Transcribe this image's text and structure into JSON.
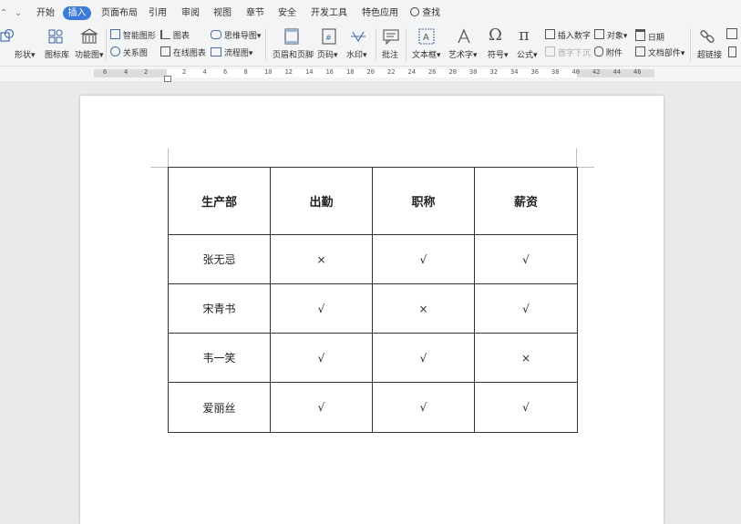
{
  "menubar": {
    "items": [
      "开始",
      "插入",
      "页面布局",
      "引用",
      "审阅",
      "视图",
      "章节",
      "安全",
      "开发工具",
      "特色应用"
    ],
    "active": "插入",
    "search": "查找"
  },
  "ribbon": {
    "shape": "形状",
    "icon_lib": "图标库",
    "function_chart": "功能图",
    "smart_graphic": "智能图形",
    "relation_chart": "关系图",
    "chart": "图表",
    "online_chart": "在线图表",
    "mind_map": "思维导图",
    "flowchart": "流程图",
    "header_footer": "页眉和页脚",
    "page_number": "页码",
    "watermark": "水印",
    "comment": "批注",
    "textbox": "文本框",
    "art_text": "艺术字",
    "symbol": "符号",
    "formula": "公式",
    "insert_number": "插入数字",
    "first_sink": "首字下沉",
    "object": "对象",
    "attachment": "附件",
    "date": "日期",
    "doc_parts": "文档部件",
    "hyperlink": "超链接"
  },
  "ruler": {
    "labels": [
      "6",
      "4",
      "2",
      "2",
      "4",
      "6",
      "8",
      "10",
      "12",
      "14",
      "16",
      "18",
      "20",
      "22",
      "24",
      "26",
      "28",
      "30",
      "32",
      "34",
      "36",
      "38",
      "40",
      "42",
      "44",
      "46"
    ]
  },
  "table": {
    "headers": [
      "生产部",
      "出勤",
      "职称",
      "薪资"
    ],
    "rows": [
      [
        "张无忌",
        "×",
        "√",
        "√"
      ],
      [
        "宋青书",
        "√",
        "×",
        "√"
      ],
      [
        "韦一笑",
        "√",
        "√",
        "×"
      ],
      [
        "爱丽丝",
        "√",
        "√",
        "√"
      ]
    ]
  }
}
